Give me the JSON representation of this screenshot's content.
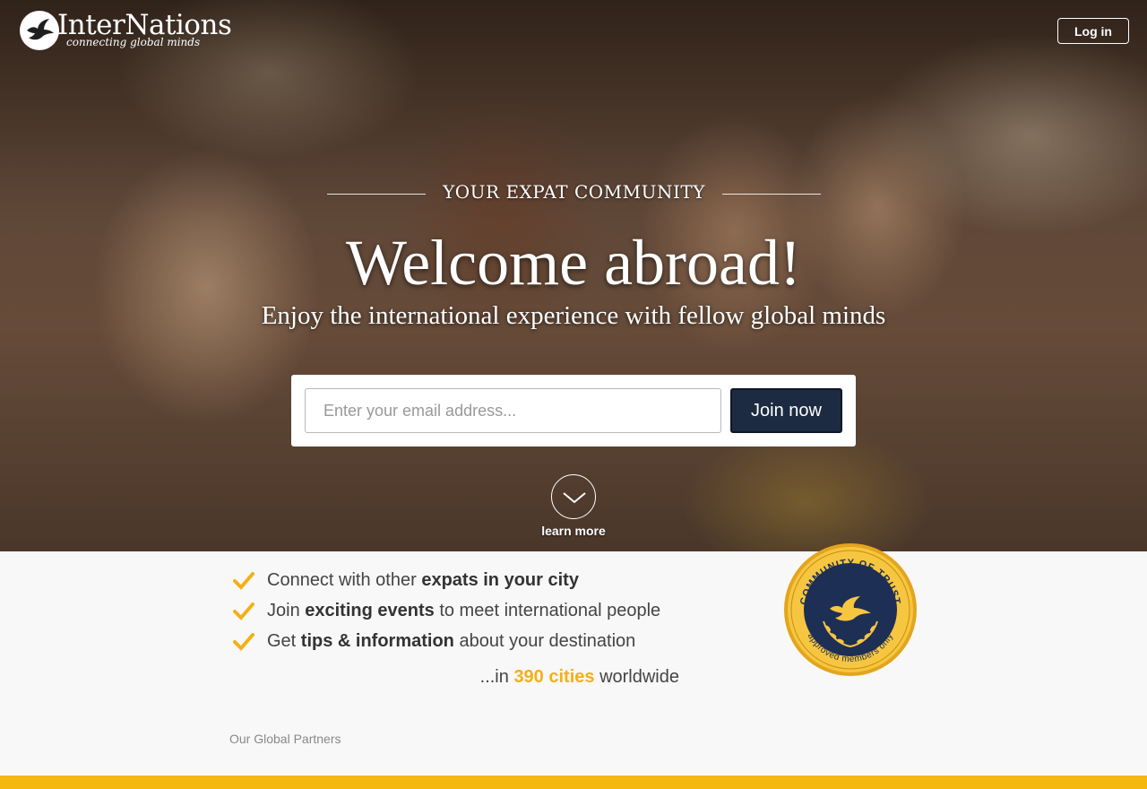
{
  "brand": {
    "name": "InterNations",
    "tagline": "connecting global minds"
  },
  "header": {
    "login_label": "Log in"
  },
  "hero": {
    "eyebrow": "YOUR EXPAT COMMUNITY",
    "headline": "Welcome abroad!",
    "subline": "Enjoy the international experience with fellow global minds",
    "email_placeholder": "Enter your email address...",
    "join_label": "Join now",
    "learn_more": "learn more"
  },
  "benefits": [
    {
      "pre": "Connect with other ",
      "bold": "expats in your city",
      "post": ""
    },
    {
      "pre": "Join ",
      "bold": "exciting events",
      "post": " to meet international people"
    },
    {
      "pre": "Get ",
      "bold": "tips & information",
      "post": " about your destination"
    }
  ],
  "cities": {
    "pre": "...in ",
    "highlight": "390 cities",
    "post": " worldwide"
  },
  "badge": {
    "top_text": "COMMUNITY OF TRUST",
    "bottom_text": "approved members only"
  },
  "partners_label": "Our Global Partners",
  "colors": {
    "accent": "#f5b015",
    "button": "#1d2b42",
    "badge_navy": "#1e2f55",
    "footer": "#f5b80f"
  }
}
